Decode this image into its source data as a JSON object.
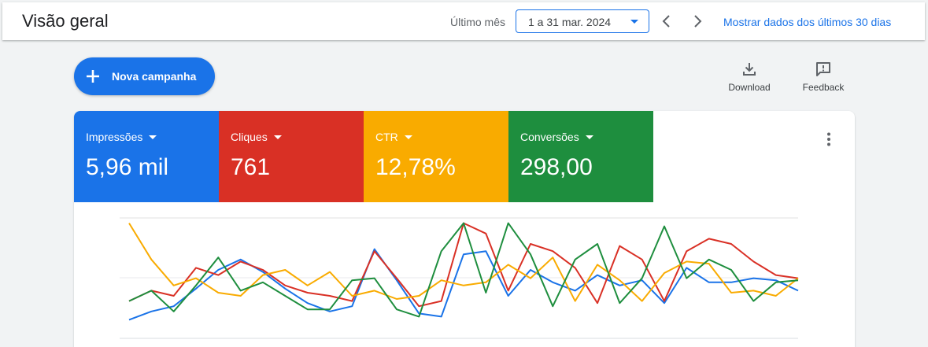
{
  "header": {
    "title": "Visão geral",
    "range_label": "Último mês",
    "date_range": "1 a 31 mar. 2024",
    "show_recent_link": "Mostrar dados dos últimos 30 dias"
  },
  "actions": {
    "new_campaign": "Nova campanha",
    "download": "Download",
    "feedback": "Feedback"
  },
  "metrics": [
    {
      "name": "Impressões",
      "value": "5,96 mil",
      "color": "#1a73e8"
    },
    {
      "name": "Cliques",
      "value": "761",
      "color": "#d93025"
    },
    {
      "name": "CTR",
      "value": "12,78%",
      "color": "#f9ab00"
    },
    {
      "name": "Conversões",
      "value": "298,00",
      "color": "#1e8e3e"
    }
  ],
  "chart_data": {
    "type": "line",
    "x": [
      1,
      2,
      3,
      4,
      5,
      6,
      7,
      8,
      9,
      10,
      11,
      12,
      13,
      14,
      15,
      16,
      17,
      18,
      19,
      20,
      21,
      22,
      23,
      24,
      25,
      26,
      27,
      28,
      29,
      30,
      31
    ],
    "ylim": [
      0,
      100
    ],
    "grid": true,
    "series": [
      {
        "color": "#1a73e8",
        "values": [
          2,
          10,
          15,
          32,
          50,
          60,
          48,
          32,
          18,
          10,
          15,
          70,
          40,
          8,
          5,
          65,
          68,
          25,
          50,
          38,
          30,
          45,
          35,
          40,
          18,
          52,
          38,
          38,
          42,
          40,
          30
        ]
      },
      {
        "color": "#d93025",
        "values": [
          20,
          30,
          25,
          52,
          45,
          58,
          50,
          35,
          28,
          25,
          20,
          68,
          42,
          15,
          20,
          95,
          85,
          30,
          75,
          68,
          52,
          18,
          73,
          60,
          20,
          68,
          80,
          75,
          58,
          45,
          42
        ]
      },
      {
        "color": "#f9ab00",
        "values": [
          95,
          60,
          35,
          42,
          28,
          25,
          45,
          50,
          35,
          48,
          25,
          30,
          22,
          25,
          40,
          35,
          38,
          55,
          42,
          62,
          20,
          55,
          40,
          20,
          47,
          58,
          56,
          28,
          30,
          25,
          42
        ]
      },
      {
        "color": "#1e8e3e",
        "values": [
          20,
          30,
          10,
          35,
          62,
          30,
          38,
          25,
          12,
          12,
          40,
          42,
          12,
          5,
          68,
          95,
          28,
          95,
          65,
          15,
          60,
          75,
          18,
          42,
          92,
          42,
          60,
          50,
          20,
          38,
          40
        ]
      }
    ]
  }
}
